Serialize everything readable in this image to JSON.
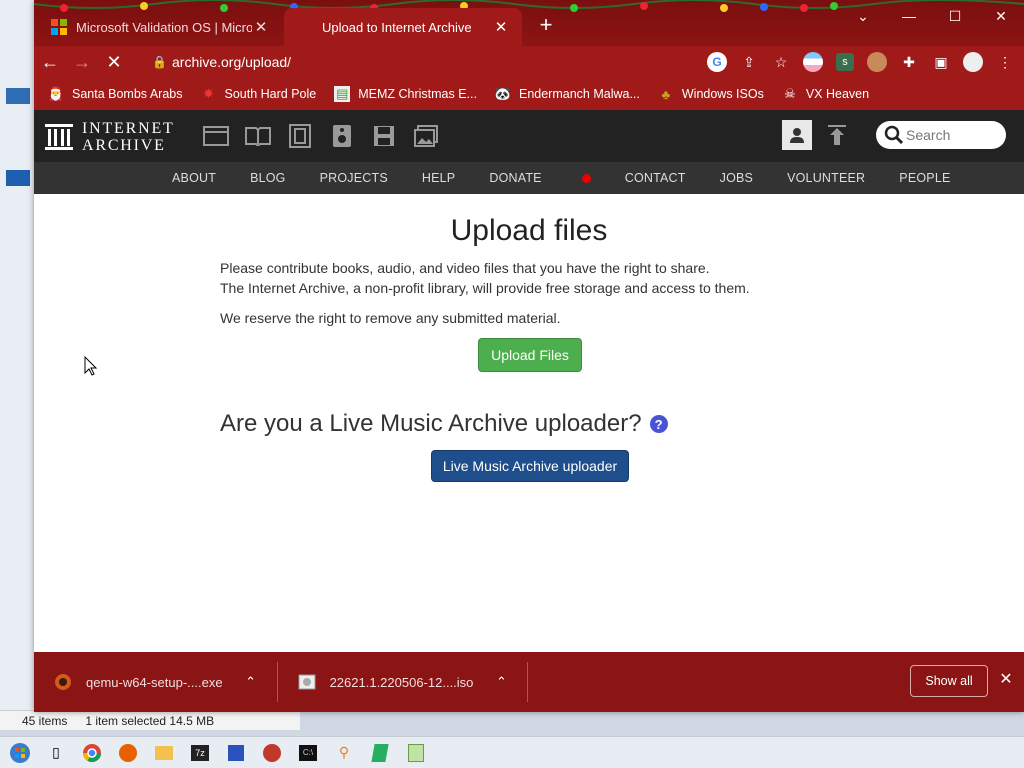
{
  "tabs": [
    {
      "title": "Microsoft Validation OS | Micros",
      "active": false
    },
    {
      "title": "Upload to Internet Archive",
      "active": true
    }
  ],
  "address": "archive.org/upload/",
  "bookmarks": [
    {
      "label": "Santa Bombs Arabs",
      "icon": "santa-icon"
    },
    {
      "label": "South Hard Pole",
      "icon": "star-icon"
    },
    {
      "label": "MEMZ Christmas E...",
      "icon": "image-icon"
    },
    {
      "label": "Endermanch Malwa...",
      "icon": "panda-icon"
    },
    {
      "label": "Windows ISOs",
      "icon": "tree-icon"
    },
    {
      "label": "VX Heaven",
      "icon": "skull-icon"
    }
  ],
  "ia": {
    "logo_line1": "INTERNET",
    "logo_line2": "ARCHIVE",
    "search_placeholder": "Search",
    "nav": [
      "ABOUT",
      "BLOG",
      "PROJECTS",
      "HELP",
      "DONATE",
      "CONTACT",
      "JOBS",
      "VOLUNTEER",
      "PEOPLE"
    ]
  },
  "content": {
    "title": "Upload files",
    "para1": "Please contribute books, audio, and video files that you have the right to share.",
    "para2": "The Internet Archive, a non-profit library, will provide free storage and access to them.",
    "para3": "We reserve the right to remove any submitted material.",
    "upload_button": "Upload Files",
    "lma_heading": "Are you a Live Music Archive uploader?",
    "help": "?",
    "lma_button": "Live Music Archive uploader"
  },
  "downloads": [
    {
      "name": "qemu-w64-setup-....exe"
    },
    {
      "name": "22621.1.220506-12....iso"
    }
  ],
  "downloads_show_all": "Show all",
  "explorer_status": {
    "items": "45 items",
    "selected": "1 item selected  14.5 MB"
  },
  "colors": {
    "chrome_red": "#a11a1a",
    "ia_dark": "#222222",
    "upload_green": "#4cae4c",
    "lma_blue": "#1f4e8c"
  }
}
